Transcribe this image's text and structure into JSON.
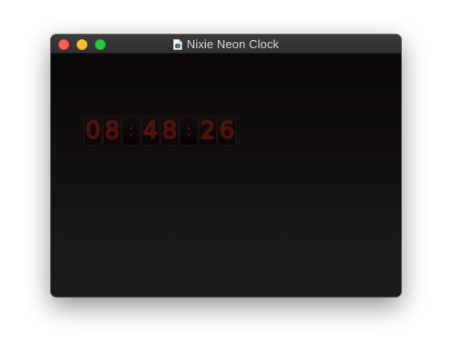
{
  "window": {
    "title": "Nixie Neon Clock",
    "title_icon": "document-app-icon"
  },
  "traffic_lights": {
    "close_color": "#fe5f57",
    "minimize_color": "#febc2e",
    "zoom_color": "#28c840"
  },
  "clock": {
    "time": "08:48:26",
    "digits": [
      "0",
      "8",
      "4",
      "8",
      "2",
      "6"
    ],
    "separator": ":",
    "glow_color": "#7a1a10"
  }
}
